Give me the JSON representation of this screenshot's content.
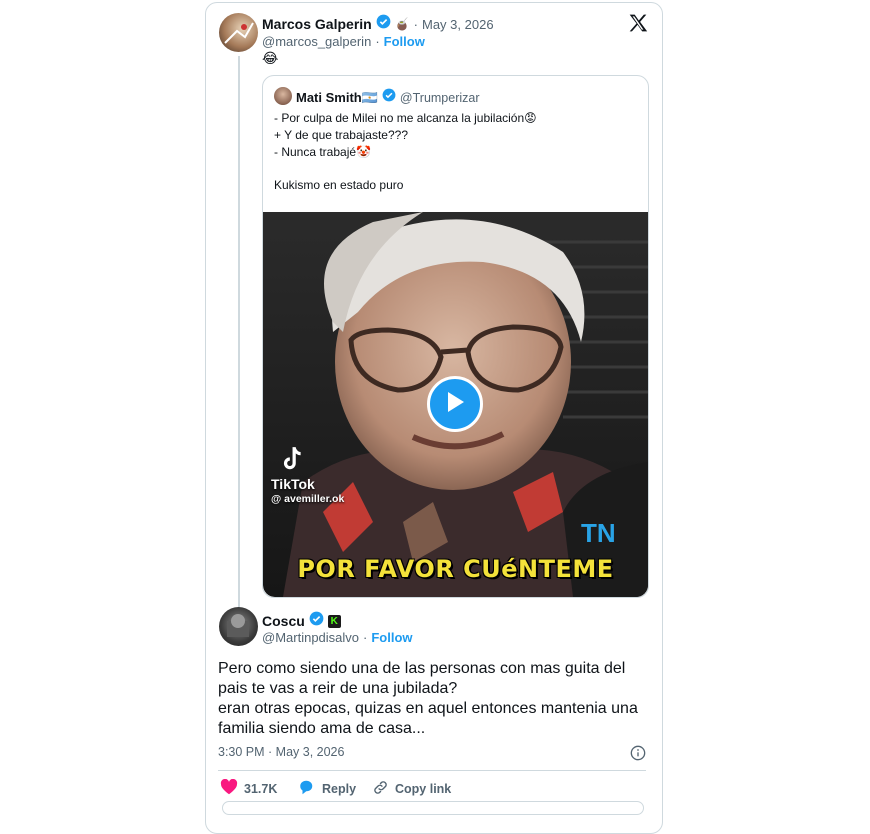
{
  "main_tweet": {
    "author_name": "Marcos Galperin",
    "badge_emoji": "🧉",
    "date_separator": "·",
    "date": "May 3, 2026",
    "handle": "@marcos_galperin",
    "follow_separator": "·",
    "follow_label": "Follow",
    "text": "😂"
  },
  "quoted_tweet": {
    "author_name": "Mati Smith🇦🇷",
    "handle": "@Trumperizar",
    "lines": [
      "- Por culpa de Milei no me alcanza la jubilación😡",
      "+ Y de que trabajaste???",
      "- Nunca trabajé🤡",
      "Kukismo en estado puro"
    ],
    "video": {
      "watermark_app": "TikTok",
      "watermark_user": "@ avemiller.ok",
      "caption": "POR FAVOR CUéNTEME",
      "channel_logo": "TN"
    }
  },
  "reply_tweet": {
    "author_name": "Coscu",
    "badge_letter": "K",
    "handle": "@Martinpdisalvo",
    "follow_separator": "·",
    "follow_label": "Follow",
    "text_lines": [
      "Pero como siendo una de las personas con mas guita del",
      "pais te vas a reir de una jubilada?",
      "eran otras epocas, quizas en aquel entonces mantenia una",
      "familia siendo ama de casa..."
    ],
    "time": "3:30 PM · May 3, 2026",
    "like_count": "31.7K",
    "reply_label": "Reply",
    "copy_link_label": "Copy link"
  },
  "colors": {
    "accent": "#1d9bf0",
    "like": "#f91880",
    "border": "#cfd9de",
    "secondary_text": "#536471"
  }
}
